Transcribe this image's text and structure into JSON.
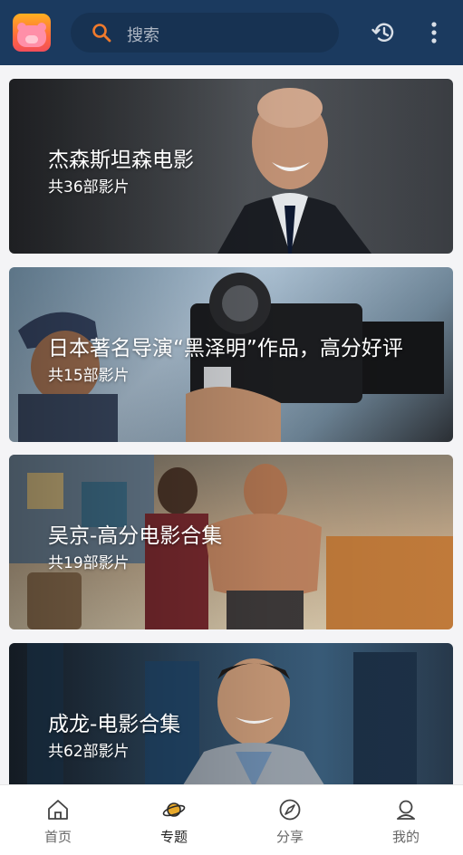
{
  "header": {
    "search_placeholder": "搜索",
    "icons": [
      "app-logo-icon",
      "search-icon",
      "history-icon",
      "more-vertical-icon"
    ]
  },
  "topics": [
    {
      "title": "杰森斯坦森电影",
      "count": "共36部影片"
    },
    {
      "title": "日本著名导演“黑泽明”作品，高分好评",
      "count": "共15部影片"
    },
    {
      "title": "吴京-高分电影合集",
      "count": "共19部影片"
    },
    {
      "title": "成龙-电影合集",
      "count": "共62部影片"
    }
  ],
  "tabbar": {
    "items": [
      {
        "label": "首页",
        "icon": "home-icon"
      },
      {
        "label": "专题",
        "icon": "planet-icon",
        "active": true
      },
      {
        "label": "分享",
        "icon": "compass-icon"
      },
      {
        "label": "我的",
        "icon": "profile-icon"
      }
    ]
  },
  "colors": {
    "header_bg": "#1b3a5f",
    "search_bg": "#173252",
    "accent_orange": "#f07a2c",
    "active_tab_icon": "#e8a92a"
  }
}
